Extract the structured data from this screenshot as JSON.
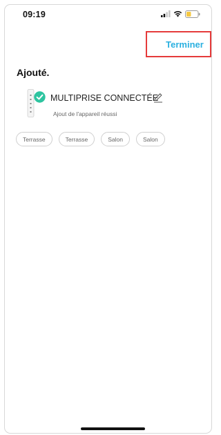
{
  "status_bar": {
    "time": "09:19",
    "icons": [
      "signal-icon",
      "wifi-icon",
      "battery-icon"
    ],
    "battery_color": "#f5c842"
  },
  "header": {
    "done_label": "Terminer",
    "accent_color": "#2bb0e0"
  },
  "page": {
    "title": "Ajouté."
  },
  "device": {
    "name": "MULTIPRISE CONNECTÉE",
    "status": "Ajout de l'appareil réussi",
    "badge_color": "#2ec4a0"
  },
  "rooms": [
    {
      "label": "Terrasse"
    },
    {
      "label": "Terrasse"
    },
    {
      "label": "Salon"
    },
    {
      "label": "Salon"
    }
  ]
}
